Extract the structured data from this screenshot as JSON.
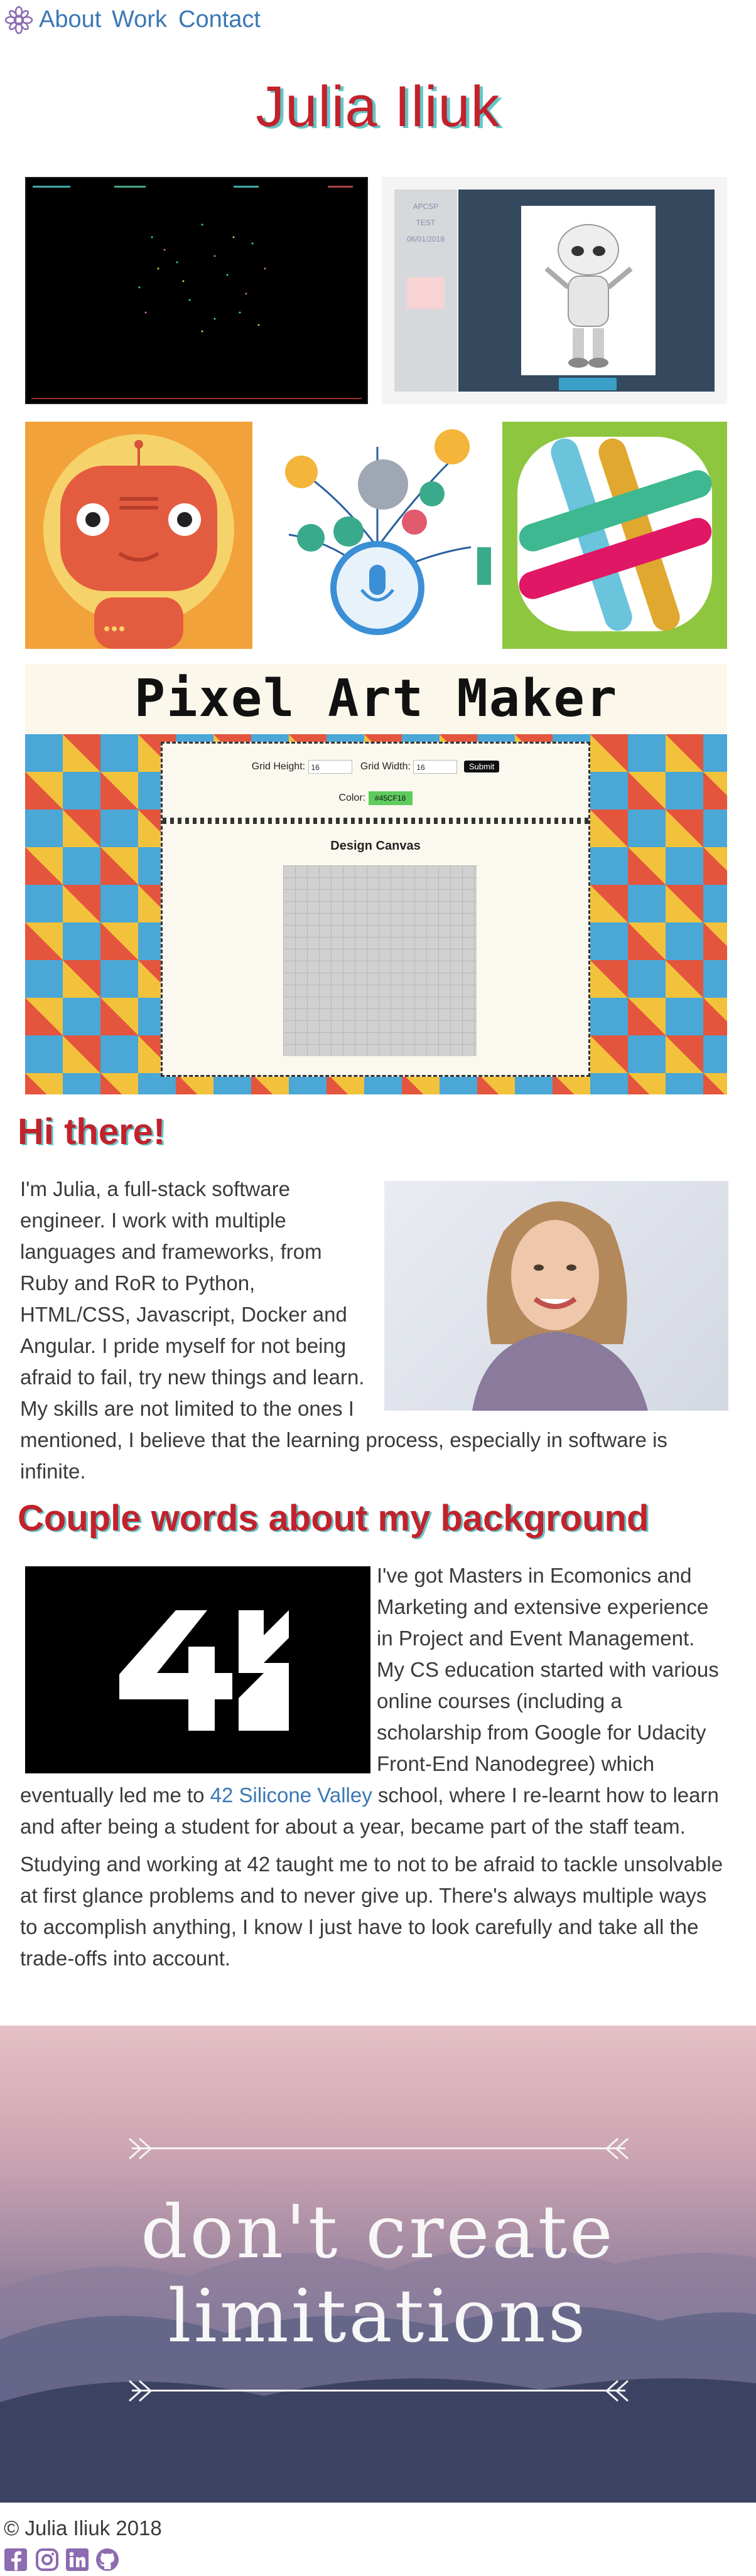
{
  "nav": {
    "logo_icon": "gear-flower-icon",
    "links": [
      "About",
      "Work",
      "Contact"
    ]
  },
  "site_title": "Julia Iliuk",
  "projects": {
    "robot_sidebar": [
      "APCSP",
      "TEST",
      "06/01/2018"
    ],
    "pixel_art": {
      "title": "Pixel Art Maker",
      "grid_height_label": "Grid Height:",
      "grid_height_value": "16",
      "grid_width_label": "Grid Width:",
      "grid_width_value": "16",
      "submit_label": "Submit",
      "color_label": "Color:",
      "color_value": "#45CF18",
      "canvas_title": "Design Canvas"
    }
  },
  "hi": {
    "heading": "Hi there!",
    "text": "I'm Julia, a full-stack software engineer. I work with multiple languages and frameworks, from Ruby and RoR to Python, HTML/CSS, Javascript, Docker and Angular. I pride myself for not being afraid to fail, try new things and learn. My skills are not limited to the ones I mentioned, I believe that the learning process, especially in software is infinite."
  },
  "background": {
    "heading": "Couple words about my background",
    "logo_text": "42",
    "text_before_link": "I've got Masters in Ecomonics and Marketing and extensive experience in Project and Event Management. My CS education started with various online courses (including a scholarship from Google for Udacity Front-End Nanodegree) which eventually led me to ",
    "link_text": "42 Silicone Valley",
    "text_after_link": "  school, where I re-learnt how to learn and after being a student for about a year, became part of the staff team.",
    "text2": "Studying and working at 42 taught me to not to be afraid to tackle unsolvable at first glance problems and to never give up. There's always multiple ways to accomplish anything, I know I just have to look carefully and take all the trade-offs into account."
  },
  "banner": {
    "line1": "don't create",
    "line2": "limitations"
  },
  "footer": {
    "copyright": "© Julia Iliuk 2018",
    "social_icons": [
      "facebook-icon",
      "instagram-icon",
      "linkedin-icon",
      "github-icon"
    ]
  },
  "colors": {
    "accent_red": "#c2222c",
    "shadow_teal": "#63c6c8",
    "link_blue": "#3a78b5",
    "nav_purple": "#8d6bb0"
  }
}
